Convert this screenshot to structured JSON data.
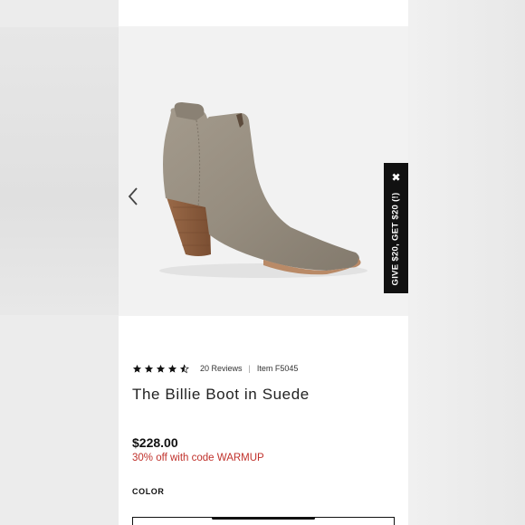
{
  "product": {
    "rating": 4.5,
    "reviews": "20 Reviews",
    "item": "Item F5045",
    "title": "The Billie Boot in Suede",
    "price": "$228.00",
    "discount": "30% off with code WARMUP",
    "color_label": "COLOR"
  },
  "promo": {
    "label": "GIVE $20, GET $20 (!)",
    "close": "✖"
  },
  "icons": {
    "prev": "chevron-left-icon",
    "close": "close-icon",
    "star": "star-icon"
  },
  "colors": {
    "discount": "#c0312b",
    "promo_bg": "#111111",
    "boot": "#938a7c"
  }
}
